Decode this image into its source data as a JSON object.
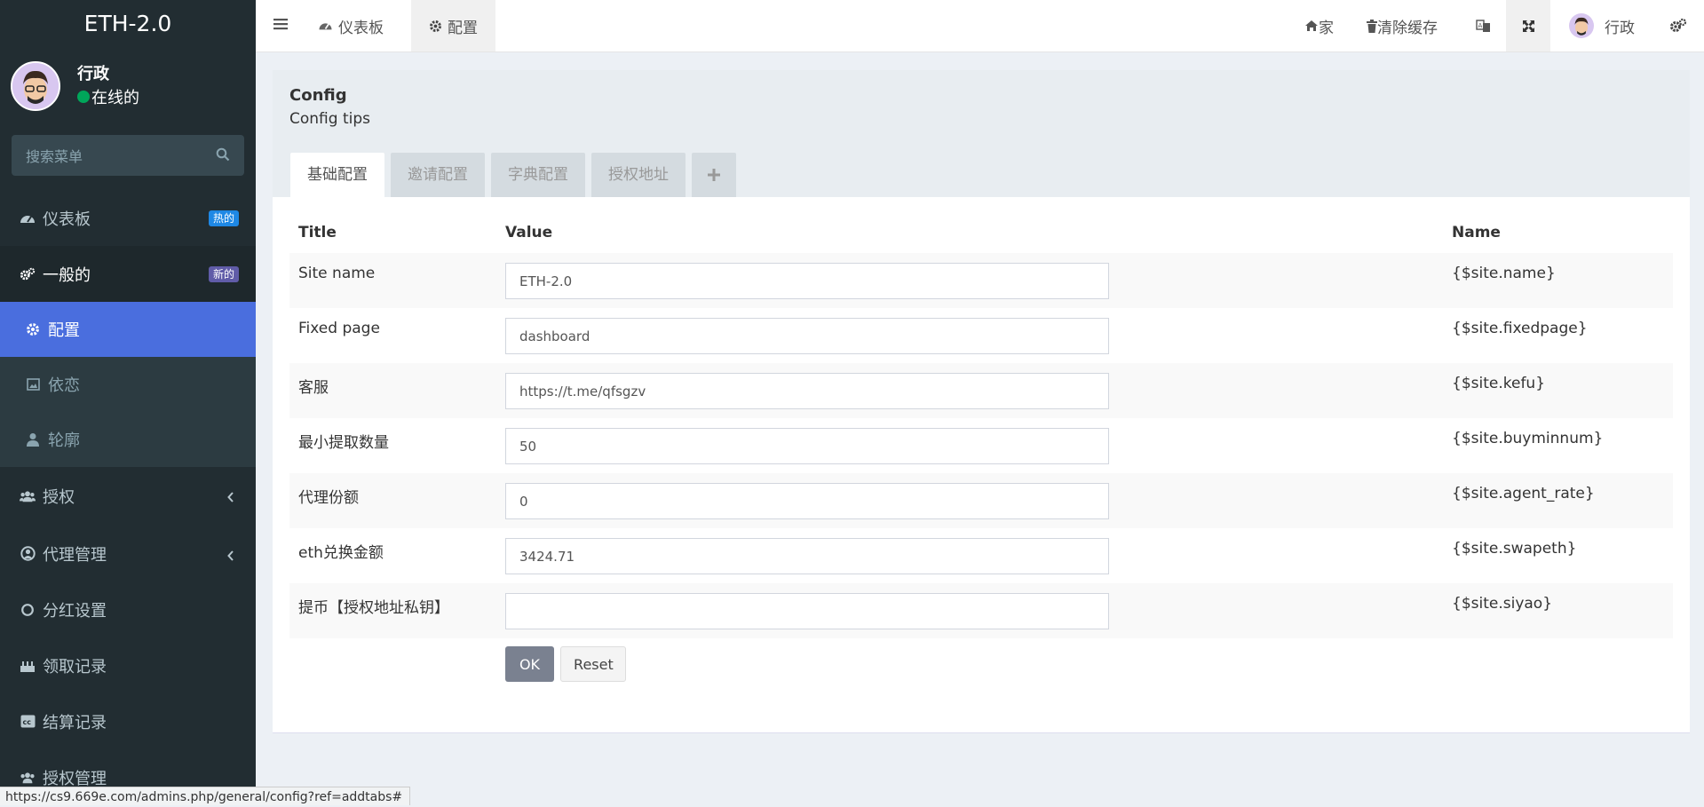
{
  "app": {
    "logo": "ETH-2.0"
  },
  "user": {
    "name": "行政",
    "status": "在线的"
  },
  "search": {
    "placeholder": "搜索菜单"
  },
  "sidebar": {
    "dashboard": {
      "label": "仪表板",
      "badge": "热的",
      "badge_color": "#1e88e5"
    },
    "general": {
      "label": "一般的",
      "badge": "新的",
      "badge_color": "#605ca8"
    },
    "sub": [
      {
        "label": "配置"
      },
      {
        "label": "依恋"
      },
      {
        "label": "轮廓"
      }
    ],
    "items": [
      {
        "label": "授权"
      },
      {
        "label": "代理管理"
      },
      {
        "label": "分红设置"
      },
      {
        "label": "领取记录"
      },
      {
        "label": "结算记录"
      },
      {
        "label": "授权管理"
      }
    ]
  },
  "header": {
    "tab_dashboard": "仪表板",
    "tab_config": "配置",
    "home": "家",
    "clear_cache": "清除缓存",
    "user": "行政"
  },
  "content": {
    "title": "Config",
    "tips": "Config tips",
    "tabs": [
      "基础配置",
      "邀请配置",
      "字典配置",
      "授权地址"
    ],
    "columns": {
      "title": "Title",
      "value": "Value",
      "name": "Name"
    },
    "rows": [
      {
        "title": "Site name",
        "value": "ETH-2.0",
        "name": "{$site.name}"
      },
      {
        "title": "Fixed page",
        "value": "dashboard",
        "name": "{$site.fixedpage}"
      },
      {
        "title": "客服",
        "value": "https://t.me/qfsgzv",
        "name": "{$site.kefu}"
      },
      {
        "title": "最小提取数量",
        "value": "50",
        "name": "{$site.buyminnum}"
      },
      {
        "title": "代理份额",
        "value": "0",
        "name": "{$site.agent_rate}"
      },
      {
        "title": "eth兑换金额",
        "value": "3424.71",
        "name": "{$site.swapeth}"
      },
      {
        "title": "提币【授权地址私钥】",
        "value": "",
        "name": "{$site.siyao}"
      }
    ],
    "ok": "OK",
    "reset": "Reset"
  },
  "status_url": "https://cs9.669e.com/admins.php/general/config?ref=addtabs#",
  "colors": {
    "sidebar_bg": "#222d32",
    "active_item": "#4a6ede",
    "ok_button": "#7a8190"
  }
}
